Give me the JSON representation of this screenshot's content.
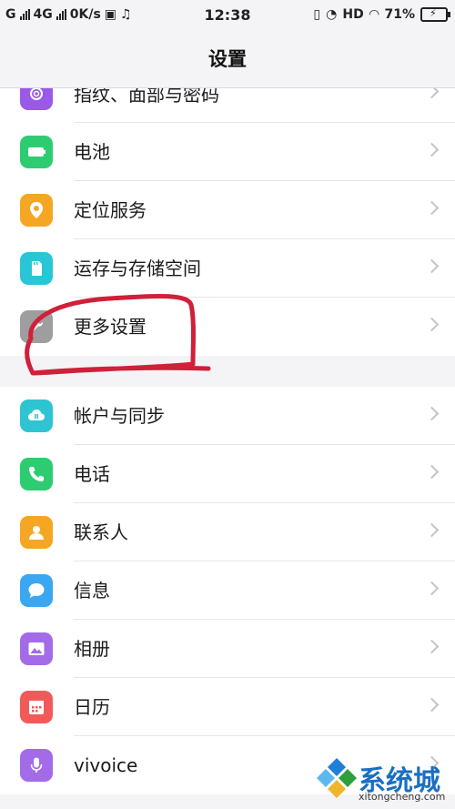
{
  "status_bar": {
    "carrier1": "G",
    "carrier2": "4G",
    "speed": "0K/s",
    "time": "12:38",
    "hd": "HD",
    "battery": "71%"
  },
  "header": {
    "title": "设置"
  },
  "groups": [
    {
      "items": [
        {
          "label": "指纹、面部与密码",
          "icon": "fingerprint-icon",
          "color": "#9b59e8",
          "partial": true
        },
        {
          "label": "电池",
          "icon": "battery-icon",
          "color": "#2ecc71"
        },
        {
          "label": "定位服务",
          "icon": "location-icon",
          "color": "#f5a623"
        },
        {
          "label": "运存与存储空间",
          "icon": "sd-card-icon",
          "color": "#29c6d8"
        },
        {
          "label": "更多设置",
          "icon": "wrench-icon",
          "color": "#9e9e9e"
        }
      ]
    },
    {
      "items": [
        {
          "label": "帐户与同步",
          "icon": "cloud-sync-icon",
          "color": "#2fc4d1"
        },
        {
          "label": "电话",
          "icon": "phone-icon",
          "color": "#2ecc71"
        },
        {
          "label": "联系人",
          "icon": "contact-icon",
          "color": "#f5a623"
        },
        {
          "label": "信息",
          "icon": "message-icon",
          "color": "#3aa7f0"
        },
        {
          "label": "相册",
          "icon": "photo-icon",
          "color": "#a36be8"
        },
        {
          "label": "日历",
          "icon": "calendar-icon",
          "color": "#f25a5a"
        },
        {
          "label": "vivoice",
          "icon": "microphone-icon",
          "color": "#a36be8"
        }
      ]
    }
  ],
  "annotation_color": "#d0203a",
  "watermark": {
    "text": "系统城",
    "url": "xitongcheng.com"
  }
}
